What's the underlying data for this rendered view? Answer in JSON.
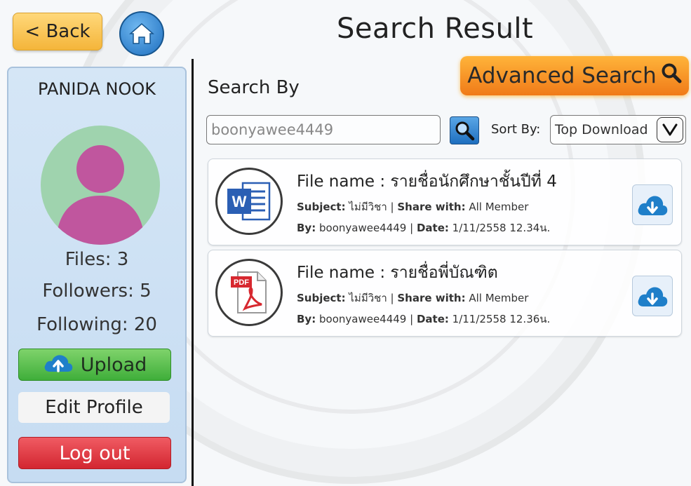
{
  "header": {
    "back_label": "< Back",
    "title": "Search Result",
    "advanced_search_label": "Advanced Search"
  },
  "sidebar": {
    "user_name": "PANIDA NOOK",
    "files": "Files: 3",
    "followers": "Followers: 5",
    "following": "Following: 20",
    "upload_label": "Upload",
    "edit_profile_label": "Edit Profile",
    "logout_label": "Log out"
  },
  "search": {
    "heading": "Search By",
    "value": "boonyawee4449",
    "sort_label": "Sort By:",
    "sort_value": "Top Download"
  },
  "results": [
    {
      "file_name": "File name : รายชื่อนักศึกษาชั้นปีที่ 4",
      "subject_label": "Subject:",
      "subject": "ไม่มีวิชา",
      "share_label": "Share with:",
      "share": "All Member",
      "by_label": "By:",
      "by": "boonyawee4449",
      "date_label": "Date:",
      "date": "1/11/2558 12.34น.",
      "icon": "word-document-icon"
    },
    {
      "file_name": "File name : รายชื่อพี่บัณฑิต",
      "subject_label": "Subject:",
      "subject": "ไม่มีวิชา",
      "share_label": "Share with:",
      "share": "All Member",
      "by_label": "By:",
      "by": "boonyawee4449",
      "date_label": "Date:",
      "date": "1/11/2558 12.36น.",
      "icon": "pdf-document-icon"
    }
  ],
  "colors": {
    "back": "#f4b53a",
    "advanced": "#f07a18",
    "upload": "#3fae3a",
    "logout": "#d32630",
    "sidebar": "#c6dcf2",
    "avatar_bg": "#9fd3ae",
    "avatar_fg": "#c0569e"
  }
}
